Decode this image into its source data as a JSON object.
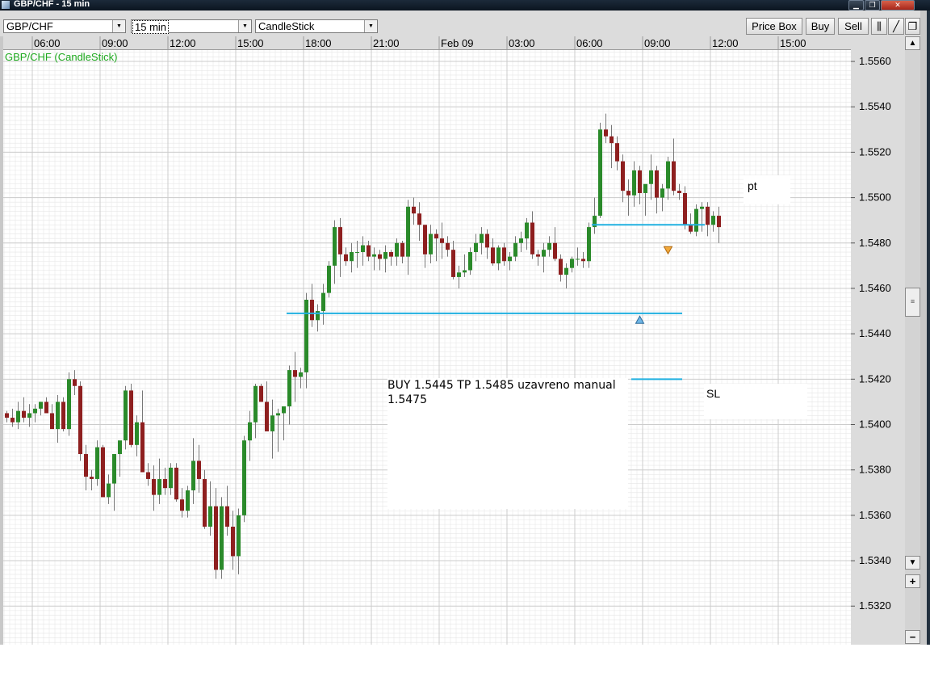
{
  "window": {
    "title": "GBP/CHF - 15 min",
    "buttons": [
      "minimize",
      "restore",
      "close"
    ]
  },
  "toolbar": {
    "symbol": "GBP/CHF",
    "interval": "15 min",
    "chart_type": "CandleStick",
    "price_box_label": "Price Box",
    "buy_label": "Buy",
    "sell_label": "Sell"
  },
  "chart": {
    "label": "GBP/CHF (CandleStick)",
    "label_color": "#1faa1f"
  },
  "annotations": {
    "trade_note_line1": "BUY 1.5445 TP 1.5485 uzavreno manual",
    "trade_note_line2": "1.5475",
    "pt_label": "pt",
    "sl_label": "SL"
  },
  "colors": {
    "bull": "#2a8a2a",
    "bear": "#8e1f1f",
    "level_line": "#20b0e0",
    "grid": "#e6e6e6",
    "grid_major": "#cccccc"
  },
  "chart_data": {
    "type": "candlestick",
    "x_tick_labels": [
      "06:00",
      "09:00",
      "12:00",
      "15:00",
      "18:00",
      "21:00",
      "Feb 09",
      "03:00",
      "06:00",
      "09:00",
      "12:00",
      "15:00"
    ],
    "y_tick_labels": [
      "1.5560",
      "1.5540",
      "1.5520",
      "1.5500",
      "1.5480",
      "1.5460",
      "1.5440",
      "1.5420",
      "1.5400",
      "1.5380",
      "1.5360",
      "1.5340",
      "1.5320"
    ],
    "ylim": [
      1.5303,
      1.5565
    ],
    "bars_per_x_tick": 12,
    "x_tick_start_bar": 5,
    "levels": [
      {
        "name": "entry",
        "value": 1.5449,
        "from_bar": 50,
        "to_bar": 120
      },
      {
        "name": "take_profit",
        "value": 1.5488,
        "from_bar": 104,
        "to_bar": 124
      },
      {
        "name": "stop_loss",
        "value": 1.542,
        "from_bar": 111,
        "to_bar": 120
      }
    ],
    "markers": [
      {
        "type": "buy",
        "bar": 112,
        "value": 1.5446
      },
      {
        "type": "sell",
        "bar": 117,
        "value": 1.5477
      }
    ],
    "ohlc": [
      [
        1.5405,
        1.5406,
        1.5401,
        1.5403
      ],
      [
        1.5403,
        1.5407,
        1.5399,
        1.5401
      ],
      [
        1.5401,
        1.541,
        1.5398,
        1.5406
      ],
      [
        1.5406,
        1.5412,
        1.5401,
        1.5403
      ],
      [
        1.5403,
        1.5409,
        1.5399,
        1.5405
      ],
      [
        1.5405,
        1.5409,
        1.5401,
        1.5407
      ],
      [
        1.5407,
        1.541,
        1.5404,
        1.541
      ],
      [
        1.541,
        1.5412,
        1.5406,
        1.5405
      ],
      [
        1.5405,
        1.5409,
        1.5399,
        1.5398
      ],
      [
        1.5398,
        1.5413,
        1.5392,
        1.541
      ],
      [
        1.541,
        1.5412,
        1.5397,
        1.5398
      ],
      [
        1.5398,
        1.5423,
        1.5395,
        1.542
      ],
      [
        1.542,
        1.5424,
        1.5413,
        1.5417
      ],
      [
        1.5417,
        1.5419,
        1.5384,
        1.5387
      ],
      [
        1.5387,
        1.5391,
        1.5371,
        1.5377
      ],
      [
        1.5377,
        1.538,
        1.5371,
        1.5376
      ],
      [
        1.5376,
        1.5393,
        1.5373,
        1.539
      ],
      [
        1.539,
        1.5391,
        1.5374,
        1.5368
      ],
      [
        1.5368,
        1.5378,
        1.5365,
        1.5374
      ],
      [
        1.5374,
        1.5385,
        1.5362,
        1.5387
      ],
      [
        1.5387,
        1.5391,
        1.5377,
        1.5393
      ],
      [
        1.5393,
        1.5417,
        1.5389,
        1.5415
      ],
      [
        1.5415,
        1.5418,
        1.539,
        1.5391
      ],
      [
        1.5391,
        1.5404,
        1.5386,
        1.5401
      ],
      [
        1.5401,
        1.5415,
        1.5387,
        1.5379
      ],
      [
        1.5379,
        1.5383,
        1.5373,
        1.5376
      ],
      [
        1.5376,
        1.5382,
        1.5362,
        1.5369
      ],
      [
        1.5369,
        1.5385,
        1.5365,
        1.5376
      ],
      [
        1.5376,
        1.5381,
        1.5369,
        1.5372
      ],
      [
        1.5372,
        1.5383,
        1.5369,
        1.5381
      ],
      [
        1.5381,
        1.5383,
        1.5366,
        1.5367
      ],
      [
        1.5367,
        1.5372,
        1.5359,
        1.5362
      ],
      [
        1.5362,
        1.5373,
        1.5359,
        1.5371
      ],
      [
        1.5371,
        1.5394,
        1.5365,
        1.5384
      ],
      [
        1.5384,
        1.5391,
        1.537,
        1.5376
      ],
      [
        1.5376,
        1.538,
        1.5354,
        1.5355
      ],
      [
        1.5355,
        1.5375,
        1.5351,
        1.5364
      ],
      [
        1.5364,
        1.5372,
        1.5332,
        1.5336
      ],
      [
        1.5336,
        1.5368,
        1.5332,
        1.5364
      ],
      [
        1.5364,
        1.5373,
        1.5351,
        1.5355
      ],
      [
        1.5355,
        1.5362,
        1.5336,
        1.5342
      ],
      [
        1.5342,
        1.5363,
        1.5334,
        1.536
      ],
      [
        1.536,
        1.5395,
        1.5357,
        1.5393
      ],
      [
        1.5393,
        1.5406,
        1.5384,
        1.5401
      ],
      [
        1.5401,
        1.5418,
        1.5394,
        1.5417
      ],
      [
        1.5417,
        1.5418,
        1.541,
        1.541
      ],
      [
        1.541,
        1.5419,
        1.5403,
        1.5397
      ],
      [
        1.5397,
        1.5411,
        1.5385,
        1.5404
      ],
      [
        1.5404,
        1.5407,
        1.5388,
        1.5405
      ],
      [
        1.5405,
        1.5408,
        1.5393,
        1.5408
      ],
      [
        1.5408,
        1.5426,
        1.54,
        1.5424
      ],
      [
        1.5424,
        1.5432,
        1.541,
        1.5421
      ],
      [
        1.5421,
        1.5425,
        1.5416,
        1.5423
      ],
      [
        1.5423,
        1.5458,
        1.5416,
        1.5455
      ],
      [
        1.5455,
        1.5462,
        1.5443,
        1.5446
      ],
      [
        1.5446,
        1.5453,
        1.5441,
        1.545
      ],
      [
        1.545,
        1.5462,
        1.5444,
        1.5458
      ],
      [
        1.5458,
        1.5472,
        1.5456,
        1.547
      ],
      [
        1.547,
        1.549,
        1.5462,
        1.5487
      ],
      [
        1.5487,
        1.5491,
        1.5465,
        1.5475
      ],
      [
        1.5475,
        1.5478,
        1.547,
        1.5472
      ],
      [
        1.5472,
        1.548,
        1.5467,
        1.5476
      ],
      [
        1.5476,
        1.5481,
        1.5469,
        1.5476
      ],
      [
        1.5476,
        1.5483,
        1.547,
        1.5479
      ],
      [
        1.5479,
        1.5481,
        1.5472,
        1.5474
      ],
      [
        1.5474,
        1.5478,
        1.5468,
        1.5475
      ],
      [
        1.5475,
        1.5477,
        1.5468,
        1.5473
      ],
      [
        1.5473,
        1.5479,
        1.5467,
        1.5476
      ],
      [
        1.5476,
        1.5477,
        1.547,
        1.5474
      ],
      [
        1.5474,
        1.5482,
        1.547,
        1.548
      ],
      [
        1.548,
        1.5481,
        1.5471,
        1.5474
      ],
      [
        1.5474,
        1.5499,
        1.5466,
        1.5496
      ],
      [
        1.5496,
        1.55,
        1.5488,
        1.5493
      ],
      [
        1.5493,
        1.5498,
        1.5481,
        1.5488
      ],
      [
        1.5488,
        1.5488,
        1.5469,
        1.5475
      ],
      [
        1.5475,
        1.5488,
        1.5471,
        1.5484
      ],
      [
        1.5484,
        1.5486,
        1.5472,
        1.5482
      ],
      [
        1.5482,
        1.5489,
        1.5473,
        1.548
      ],
      [
        1.548,
        1.5483,
        1.5474,
        1.5477
      ],
      [
        1.5477,
        1.5481,
        1.5464,
        1.5465
      ],
      [
        1.5465,
        1.547,
        1.546,
        1.5467
      ],
      [
        1.5467,
        1.5475,
        1.5465,
        1.5468
      ],
      [
        1.5468,
        1.5478,
        1.5466,
        1.5476
      ],
      [
        1.5476,
        1.5484,
        1.5472,
        1.548
      ],
      [
        1.548,
        1.5487,
        1.5475,
        1.5484
      ],
      [
        1.5484,
        1.5486,
        1.5473,
        1.5478
      ],
      [
        1.5478,
        1.5482,
        1.547,
        1.5471
      ],
      [
        1.5471,
        1.5479,
        1.5468,
        1.5478
      ],
      [
        1.5478,
        1.548,
        1.547,
        1.5472
      ],
      [
        1.5472,
        1.5476,
        1.5468,
        1.5474
      ],
      [
        1.5474,
        1.5483,
        1.5472,
        1.548
      ],
      [
        1.548,
        1.5485,
        1.5476,
        1.5482
      ],
      [
        1.5482,
        1.5491,
        1.5477,
        1.5489
      ],
      [
        1.5489,
        1.5494,
        1.5473,
        1.5475
      ],
      [
        1.5475,
        1.5477,
        1.547,
        1.5474
      ],
      [
        1.5474,
        1.548,
        1.5467,
        1.5477
      ],
      [
        1.5477,
        1.5483,
        1.5474,
        1.548
      ],
      [
        1.548,
        1.5487,
        1.5472,
        1.5473
      ],
      [
        1.5473,
        1.5475,
        1.5463,
        1.5466
      ],
      [
        1.5466,
        1.5471,
        1.546,
        1.5469
      ],
      [
        1.5469,
        1.5474,
        1.5467,
        1.5473
      ],
      [
        1.5473,
        1.5478,
        1.547,
        1.5473
      ],
      [
        1.5473,
        1.5476,
        1.5469,
        1.5472
      ],
      [
        1.5472,
        1.5489,
        1.5469,
        1.5487
      ],
      [
        1.5487,
        1.55,
        1.5484,
        1.5492
      ],
      [
        1.5492,
        1.5533,
        1.5491,
        1.553
      ],
      [
        1.553,
        1.5537,
        1.5524,
        1.5527
      ],
      [
        1.5527,
        1.5532,
        1.5513,
        1.5524
      ],
      [
        1.5524,
        1.5527,
        1.5512,
        1.5516
      ],
      [
        1.5516,
        1.5519,
        1.5498,
        1.5503
      ],
      [
        1.5503,
        1.5508,
        1.5492,
        1.5501
      ],
      [
        1.5501,
        1.5516,
        1.5496,
        1.5512
      ],
      [
        1.5512,
        1.5514,
        1.5497,
        1.5502
      ],
      [
        1.5502,
        1.5505,
        1.5492,
        1.5506
      ],
      [
        1.5506,
        1.5519,
        1.5499,
        1.5512
      ],
      [
        1.5512,
        1.5514,
        1.5493,
        1.55
      ],
      [
        1.55,
        1.5506,
        1.5494,
        1.5504
      ],
      [
        1.5504,
        1.5518,
        1.5499,
        1.5516
      ],
      [
        1.5516,
        1.5526,
        1.5501,
        1.5503
      ],
      [
        1.5503,
        1.5506,
        1.5499,
        1.5502
      ],
      [
        1.5502,
        1.5505,
        1.5486,
        1.5488
      ],
      [
        1.5488,
        1.5493,
        1.5484,
        1.5485
      ],
      [
        1.5485,
        1.5497,
        1.5483,
        1.5495
      ],
      [
        1.5495,
        1.5498,
        1.5485,
        1.5496
      ],
      [
        1.5496,
        1.5498,
        1.5483,
        1.5488
      ],
      [
        1.5488,
        1.5494,
        1.5485,
        1.5492
      ],
      [
        1.5492,
        1.5496,
        1.548,
        1.5487
      ]
    ]
  }
}
